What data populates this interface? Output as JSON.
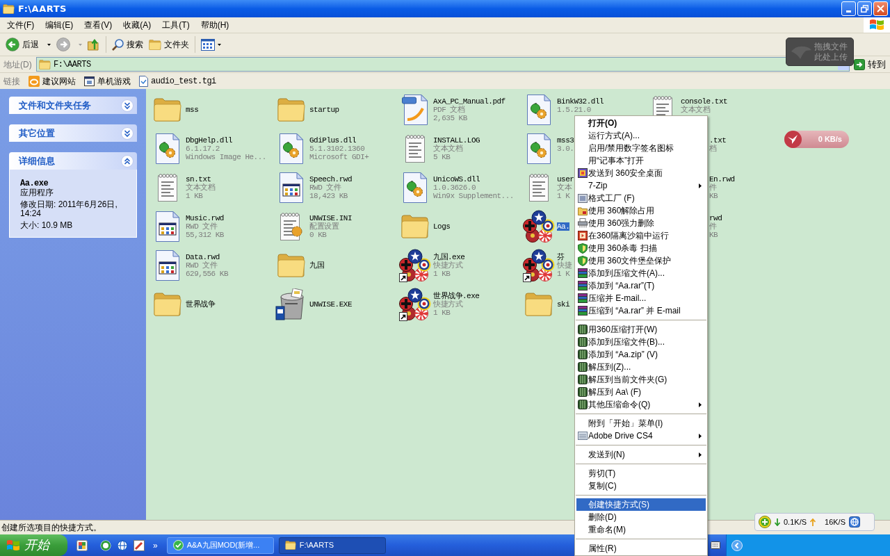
{
  "window": {
    "title": "F:\\AARTS"
  },
  "menu_bar": [
    "文件(F)",
    "编辑(E)",
    "查看(V)",
    "收藏(A)",
    "工具(T)",
    "帮助(H)"
  ],
  "toolbar": [
    {
      "kind": "back",
      "label": "后退",
      "disabled": false
    },
    {
      "kind": "forward",
      "disabled": true
    },
    {
      "kind": "up",
      "disabled": false
    },
    {
      "kind": "search",
      "label": "搜索",
      "disabled": false
    },
    {
      "kind": "folders",
      "label": "文件夹",
      "disabled": false
    },
    {
      "kind": "views",
      "disabled": false
    }
  ],
  "address_bar": {
    "label": "地址(D)",
    "value": "F:\\AARTS",
    "go_label": "转到"
  },
  "links_bar": {
    "label": "链接",
    "links": [
      {
        "kind": "site",
        "label": "建议网站"
      },
      {
        "kind": "game",
        "label": "单机游戏"
      },
      {
        "kind": "file",
        "label": "audio_test.tgi"
      }
    ]
  },
  "upload_widget": {
    "lines": [
      "拖拽文件",
      "此处上传"
    ]
  },
  "sidebar": {
    "panels": [
      {
        "title": "文件和文件夹任务",
        "expanded": false
      },
      {
        "title": "其它位置",
        "expanded": false
      },
      {
        "title": "详细信息",
        "expanded": true,
        "name": "Aa.exe",
        "type": "应用程序",
        "lines": [
          "修改日期: 2011年6月26日, 14:24",
          "大小: 10.9 MB"
        ]
      }
    ]
  },
  "files": {
    "rows": [
      [
        {
          "kind": "folder",
          "name": "mss",
          "selected": false
        },
        {
          "kind": "folder",
          "name": "startup",
          "selected": false
        },
        {
          "kind": "pdf",
          "name": "AxA_PC_Manual.pdf",
          "lines": [
            "PDF 文档",
            "2,635 KB"
          ],
          "selected": false
        },
        {
          "kind": "dll",
          "name": "BinkW32.dll",
          "lines": [
            "1.5.21.0"
          ],
          "selected": false
        },
        {
          "kind": "text",
          "name": "console.txt",
          "lines": [
            "文本文档"
          ],
          "selected": false
        }
      ],
      [
        {
          "kind": "dll",
          "name": "DbgHelp.dll",
          "lines": [
            "6.1.17.2",
            "Windows Image He..."
          ],
          "selected": false
        },
        {
          "kind": "dll",
          "name": "GdiPlus.dll",
          "lines": [
            "5.1.3102.1360",
            "Microsoft GDI+"
          ],
          "selected": false
        },
        {
          "kind": "text",
          "name": "INSTALL.LOG",
          "lines": [
            "文本文档",
            "5 KB"
          ],
          "selected": false
        },
        {
          "kind": "dll",
          "name": "mss3",
          "lines": [
            "3.0."
          ],
          "selected": false
        },
        {
          "kind": "covered",
          "name": ".txt",
          "lines": [
            "档"
          ],
          "selected": false
        }
      ],
      [
        {
          "kind": "text",
          "name": "sn.txt",
          "lines": [
            "文本文档",
            "1 KB"
          ],
          "selected": false
        },
        {
          "kind": "rwd",
          "name": "Speech.rwd",
          "lines": [
            "RWD 文件",
            "18,423 KB"
          ],
          "selected": false
        },
        {
          "kind": "dll",
          "name": "UnicoWS.dll",
          "lines": [
            "1.0.3626.0",
            "Win9x Supplement..."
          ],
          "selected": false
        },
        {
          "kind": "text",
          "name": "user",
          "lines": [
            "文本",
            "1 K"
          ],
          "selected": false
        },
        {
          "kind": "covered",
          "name": "En.rwd",
          "lines": [
            "件",
            "KB"
          ],
          "selected": false
        }
      ],
      [
        {
          "kind": "rwd",
          "name": "Music.rwd",
          "lines": [
            "RWD 文件",
            "55,312 KB"
          ],
          "selected": false
        },
        {
          "kind": "ini",
          "name": "UNWISE.INI",
          "lines": [
            "配置设置",
            "0 KB"
          ],
          "selected": false
        },
        {
          "kind": "folder",
          "name": "Logs",
          "selected": false
        },
        {
          "kind": "game",
          "name": "Aa.",
          "selected": true
        },
        {
          "kind": "covered",
          "name": "rwd",
          "lines": [
            "件",
            "KB"
          ],
          "selected": false
        }
      ],
      [
        {
          "kind": "rwd",
          "name": "Data.rwd",
          "lines": [
            "RWD 文件",
            "629,556 KB"
          ],
          "selected": false
        },
        {
          "kind": "folder",
          "name": "九国",
          "selected": false
        },
        {
          "kind": "shortcut",
          "name": "九国.exe",
          "lines": [
            "快捷方式",
            "1 KB"
          ],
          "selected": false
        },
        {
          "kind": "shortcut",
          "name": "芬",
          "lines": [
            "快捷",
            "1 K"
          ],
          "selected": false
        }
      ],
      [
        {
          "kind": "folder",
          "name": "世界战争",
          "selected": false
        },
        {
          "kind": "installer",
          "name": "UNWISE.EXE",
          "selected": false
        },
        {
          "kind": "shortcut",
          "name": "世界战争.exe",
          "lines": [
            "快捷方式",
            "1 KB"
          ],
          "selected": false
        },
        {
          "kind": "folder",
          "name": "ski",
          "selected": false
        }
      ]
    ]
  },
  "speed_widget": {
    "reading": "0 KB/s"
  },
  "context_menu": {
    "groups": [
      [
        {
          "kind": "plain",
          "label": "打开(O)",
          "default": true,
          "selected": false
        },
        {
          "kind": "plain",
          "label": "运行方式(A)...",
          "selected": false
        },
        {
          "kind": "plain",
          "label": "启用/禁用数字签名图标",
          "selected": false
        },
        {
          "kind": "plain",
          "label": "用“记事本”打开",
          "selected": false
        },
        {
          "kind": "desktop",
          "label": "发送到 360安全桌面",
          "selected": false
        },
        {
          "kind": "plain",
          "label": "7-Zip",
          "submenu": true,
          "selected": false
        },
        {
          "kind": "converter",
          "label": "格式工厂 (F)",
          "selected": false
        },
        {
          "kind": "unlock",
          "label": "使用 360解除占用",
          "selected": false
        },
        {
          "kind": "shredder",
          "label": "使用 360强力删除",
          "selected": false
        },
        {
          "kind": "sandbox",
          "label": "在360隔离沙箱中运行",
          "selected": false
        },
        {
          "kind": "shield",
          "label": "使用 360杀毒 扫描",
          "selected": false
        },
        {
          "kind": "shield",
          "label": "使用 360文件堡垒保护",
          "selected": false
        },
        {
          "kind": "books",
          "label": "添加到压缩文件(A)...",
          "selected": false
        },
        {
          "kind": "books",
          "label": "添加到 “Aa.rar”(T)",
          "selected": false
        },
        {
          "kind": "books",
          "label": "压缩并 E-mail...",
          "selected": false
        },
        {
          "kind": "books",
          "label": "压缩到 “Aa.rar” 并 E-mail",
          "selected": false
        }
      ],
      [
        {
          "kind": "archive",
          "label": "用360压缩打开(W)",
          "selected": false
        },
        {
          "kind": "archive",
          "label": "添加到压缩文件(B)...",
          "selected": false
        },
        {
          "kind": "archive",
          "label": "添加到 “Aa.zip” (V)",
          "selected": false
        },
        {
          "kind": "archive",
          "label": "解压到(Z)...",
          "selected": false
        },
        {
          "kind": "archive",
          "label": "解压到当前文件夹(G)",
          "selected": false
        },
        {
          "kind": "archive",
          "label": "解压到 Aa\\ (F)",
          "selected": false
        },
        {
          "kind": "archive",
          "label": "其他压缩命令(Q)",
          "submenu": true,
          "selected": false
        }
      ],
      [
        {
          "kind": "plain",
          "label": "附到「开始」菜单(I)",
          "selected": false
        },
        {
          "kind": "drive",
          "label": "Adobe Drive CS4",
          "submenu": true,
          "selected": false
        }
      ],
      [
        {
          "kind": "plain",
          "label": "发送到(N)",
          "submenu": true,
          "selected": false
        }
      ],
      [
        {
          "kind": "plain",
          "label": "剪切(T)",
          "selected": false
        },
        {
          "kind": "plain",
          "label": "复制(C)",
          "selected": false
        }
      ],
      [
        {
          "kind": "plain",
          "label": "创建快捷方式(S)",
          "selected": true
        },
        {
          "kind": "plain",
          "label": "删除(D)",
          "selected": false
        },
        {
          "kind": "plain",
          "label": "重命名(M)",
          "selected": false
        }
      ],
      [
        {
          "kind": "plain",
          "label": "属性(R)",
          "selected": false
        }
      ]
    ]
  },
  "status_bar": {
    "text": "创建所选项目的快捷方式。"
  },
  "net_meter": {
    "download": "0.1K/S",
    "upload": "16K/S"
  },
  "taskbar": {
    "start_label": "开始",
    "more": "»",
    "tasks": [
      {
        "kind": "app",
        "label": "A&A九国MOD(新增...",
        "selected": false
      },
      {
        "kind": "folder",
        "label": "F:\\AARTS",
        "selected": true
      }
    ]
  }
}
